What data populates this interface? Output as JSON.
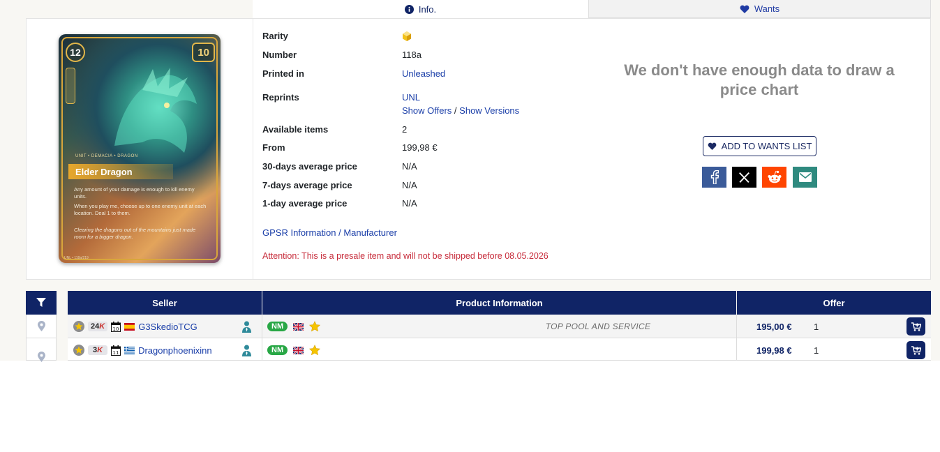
{
  "tabs": {
    "info_label": "Info.",
    "wants_label": "Wants"
  },
  "card": {
    "cost": "12",
    "power": "10",
    "tags": "UNIT • DEMACIA • DRAGON",
    "name": "Elder Dragon",
    "text_1": "Any amount of your damage is enough to kill enemy units.",
    "text_2": "When you play me, choose up to one enemy unit at each location. Deal 1 to them.",
    "flavor": "Clearing the dragons out of the mountains just made room for a bigger dragon.",
    "footer": "UNL • 118a/219"
  },
  "info": {
    "rarity_label": "Rarity",
    "rarity_icon": "rarity-gem-icon",
    "number_label": "Number",
    "number_value": "118a",
    "printed_label": "Printed in",
    "printed_value": "Unleashed",
    "reprints_label": "Reprints",
    "reprints_value": "UNL",
    "show_offers": "Show Offers",
    "separator": "/",
    "show_versions": "Show Versions",
    "available_label": "Available items",
    "available_value": "2",
    "from_label": "From",
    "from_value": "199,98 €",
    "avg30_label": "30-days average price",
    "avg30_value": "N/A",
    "avg7_label": "7-days average price",
    "avg7_value": "N/A",
    "avg1_label": "1-day average price",
    "avg1_value": "N/A",
    "gpsr_link": "GPSR Information / Manufacturer",
    "attention": "Attention: This is a presale item and will not be shipped before 08.05.2026"
  },
  "right": {
    "chart_message": "We don't have enough data to draw a price chart",
    "add_wants_label": "ADD TO WANTS LIST"
  },
  "table": {
    "headers": {
      "seller": "Seller",
      "product": "Product Information",
      "offer": "Offer"
    },
    "rows": [
      {
        "sales_num": "24",
        "sales_k": "K",
        "flag": "ES",
        "seller": "G3SkedioTCG",
        "condition": "NM",
        "language": "EN",
        "comment": "TOP POOL AND SERVICE",
        "price": "195,00 €",
        "qty": "1"
      },
      {
        "sales_num": "3",
        "sales_k": "K",
        "flag": "GR",
        "seller": "Dragonphoenixinn",
        "condition": "NM",
        "language": "EN",
        "comment": "",
        "price": "199,98 €",
        "qty": "1"
      }
    ]
  },
  "colors": {
    "navy": "#102466",
    "link": "#1a3ea8",
    "attention": "#c72c3b",
    "nm_green": "#28a745"
  }
}
